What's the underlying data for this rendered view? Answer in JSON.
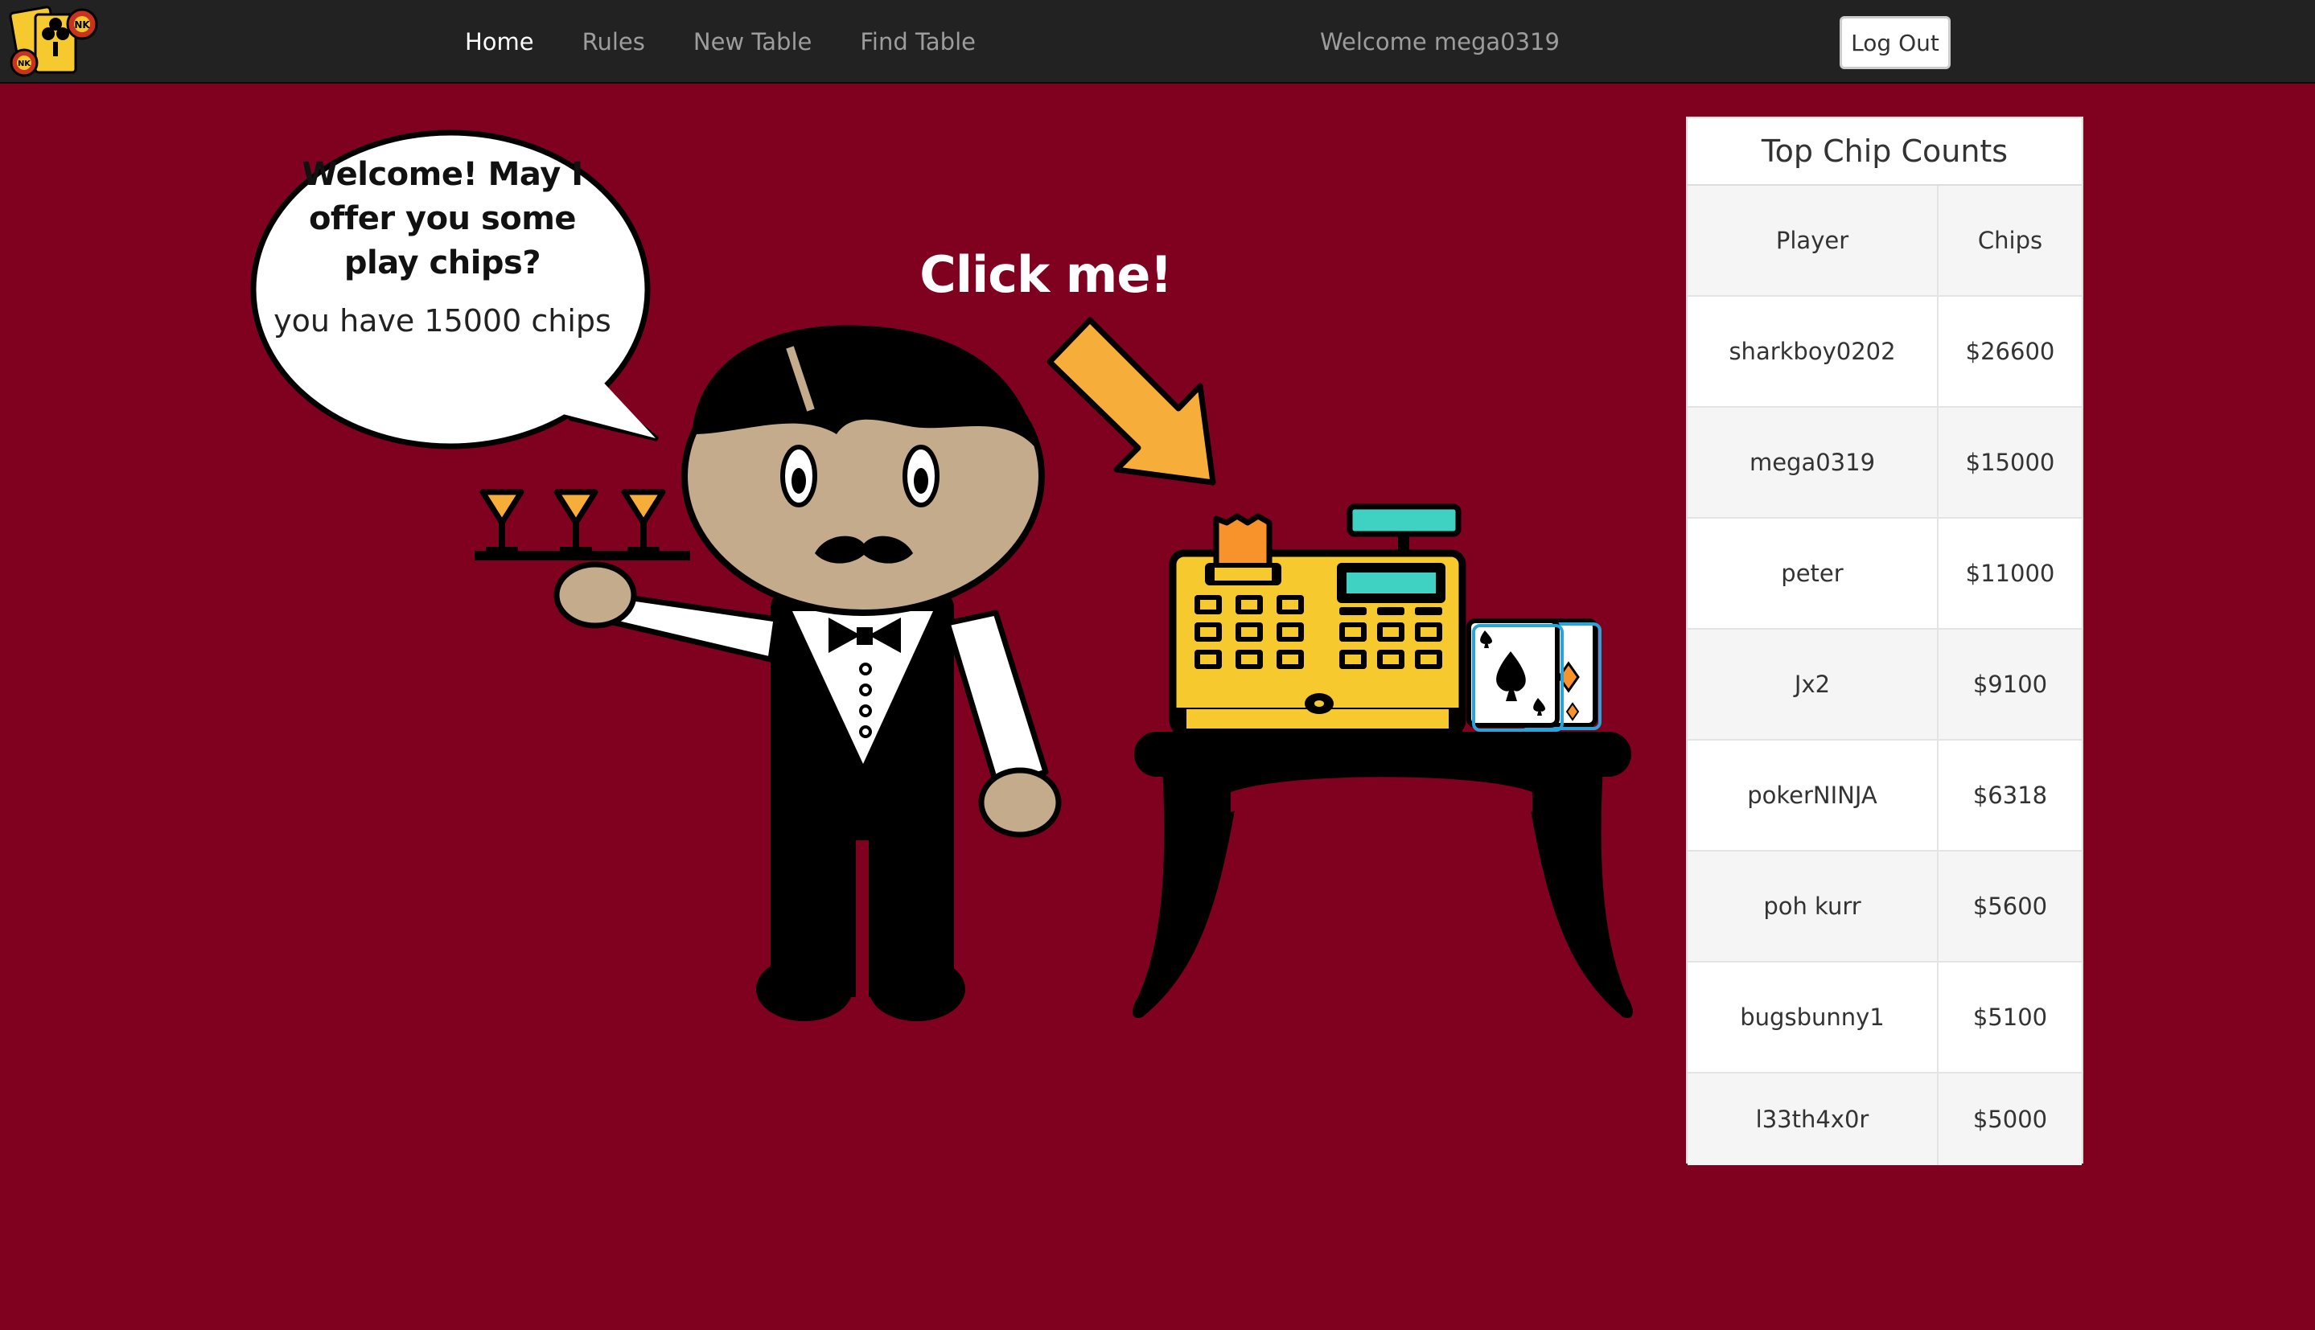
{
  "nav": {
    "brand_icon": "card-chip-logo-icon",
    "links": [
      {
        "label": "Home",
        "active": true
      },
      {
        "label": "Rules",
        "active": false
      },
      {
        "label": "New Table",
        "active": false
      },
      {
        "label": "Find Table",
        "active": false
      }
    ],
    "welcome": "Welcome mega0319",
    "logout_label": "Log Out"
  },
  "scene": {
    "bubble_lines": [
      "Welcome! May I",
      "offer you some",
      "play chips?"
    ],
    "chips_text": "you have 15000 chips",
    "click_me": "Click me!"
  },
  "leaderboard": {
    "title": "Top Chip Counts",
    "headers": [
      "Player",
      "Chips"
    ],
    "rows": [
      {
        "player": "sharkboy0202",
        "chips": "$26600"
      },
      {
        "player": "mega0319",
        "chips": "$15000"
      },
      {
        "player": "peter",
        "chips": "$11000"
      },
      {
        "player": "Jx2",
        "chips": "$9100"
      },
      {
        "player": "pokerNINJA",
        "chips": "$6318"
      },
      {
        "player": "poh kurr",
        "chips": "$5600"
      },
      {
        "player": "bugsbunny1",
        "chips": "$5100"
      },
      {
        "player": "l33th4x0r",
        "chips": "$5000"
      }
    ]
  },
  "colors": {
    "background": "#7f001f",
    "navbar": "#222222",
    "register": "#f6c92e",
    "arrow": "#f7ad39",
    "screen": "#3fd1c2"
  }
}
